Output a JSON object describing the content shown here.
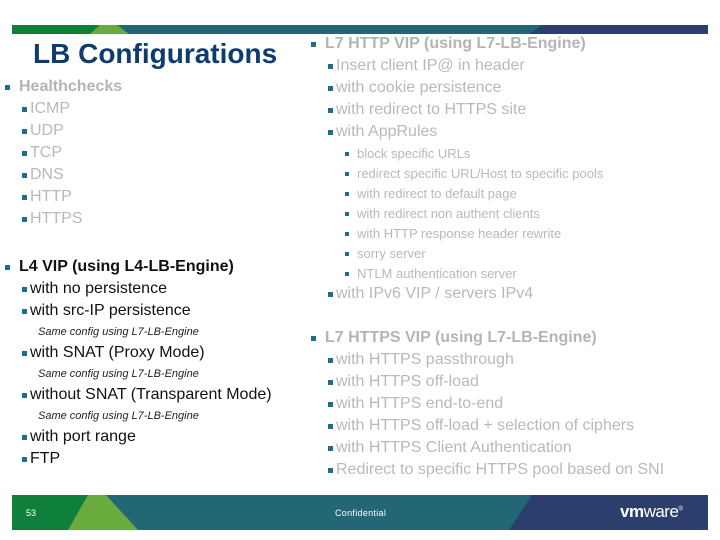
{
  "slide": {
    "title": "LB Configurations",
    "page_number": "53",
    "footer_label": "Confidential",
    "logo": {
      "bold_part": "vm",
      "light_part": "ware",
      "mark": "®"
    },
    "colors": {
      "title": "#0e3c6e",
      "bullet": "#1d6e8e",
      "band_green": "#0f7f3c",
      "band_light_green": "#6aab3e",
      "band_teal": "#236776",
      "band_navy": "#2c3f6c",
      "dim_text": "#b9b9b9",
      "active_text": "#111111"
    }
  },
  "left": {
    "healthchecks": {
      "heading": "Healthchecks",
      "items": [
        "ICMP",
        "UDP",
        "TCP",
        "DNS",
        "HTTP",
        "HTTPS"
      ]
    },
    "l4": {
      "heading": "L4 VIP (using L4-LB-Engine)",
      "items": [
        {
          "label": "with no persistence",
          "note": ""
        },
        {
          "label": "with src-IP persistence",
          "note": "Same config using L7-LB-Engine"
        },
        {
          "label": "with SNAT (Proxy Mode)",
          "note": "Same config using L7-LB-Engine"
        },
        {
          "label": "without SNAT (Transparent Mode)",
          "note": "Same config using L7-LB-Engine"
        },
        {
          "label": "with port range",
          "note": ""
        },
        {
          "label": "FTP",
          "note": ""
        }
      ]
    }
  },
  "right": {
    "http": {
      "heading": "L7 HTTP VIP (using L7-LB-Engine)",
      "items": [
        "Insert client IP@ in header",
        "with cookie persistence",
        "with redirect to HTTPS site",
        "with AppRules"
      ],
      "apprules": [
        "block specific URLs",
        "redirect specific URL/Host to specific pools",
        "with redirect to default page",
        "with redirect non authent clients",
        "with HTTP response header rewrite",
        "sorry server",
        "NTLM authentication server"
      ],
      "last_item": "with IPv6 VIP / servers IPv4"
    },
    "https": {
      "heading": "L7 HTTPS VIP (using L7-LB-Engine)",
      "items": [
        "with HTTPS passthrough",
        "with HTTPS off-load",
        "with HTTPS end-to-end",
        "with HTTPS off-load + selection of ciphers",
        "with HTTPS Client Authentication",
        "Redirect to specific HTTPS pool based on SNI"
      ]
    }
  }
}
